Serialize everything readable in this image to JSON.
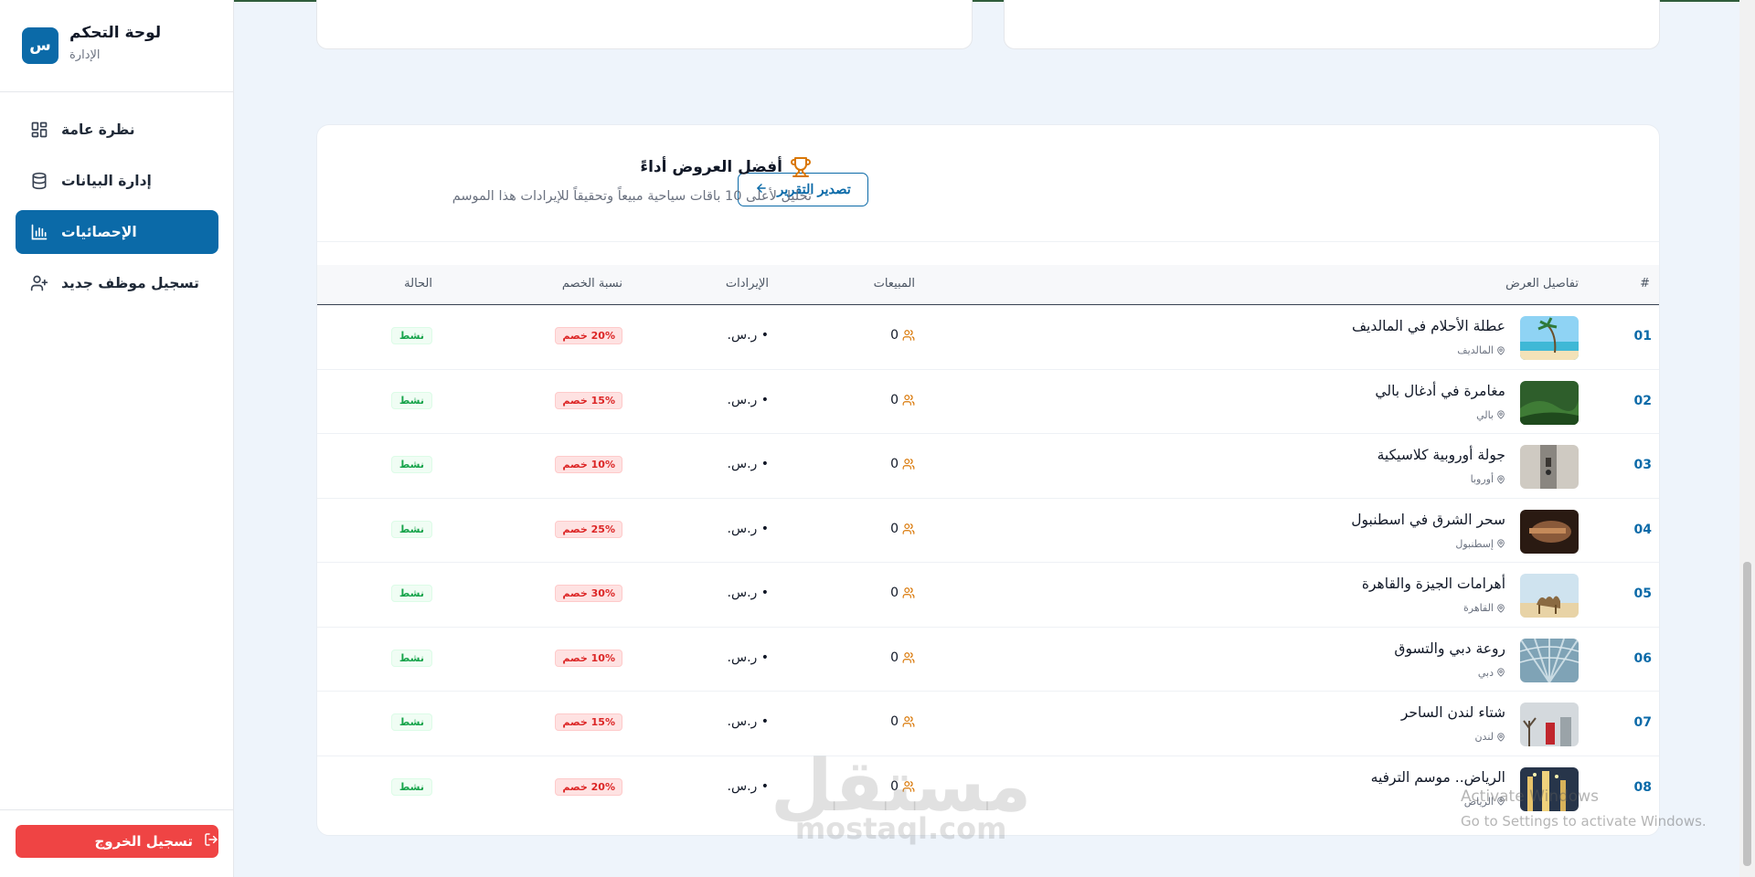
{
  "sidebar": {
    "brand_initial": "س",
    "brand_title": "لوحة التحكم",
    "brand_subtitle": "الإدارة",
    "items": [
      {
        "label": "نظرة عامة",
        "icon": "grid-icon",
        "active": false
      },
      {
        "label": "إدارة البيانات",
        "icon": "database-icon",
        "active": false
      },
      {
        "label": "الإحصائيات",
        "icon": "bar-chart-icon",
        "active": true
      },
      {
        "label": "تسجيل موظف جديد",
        "icon": "user-plus-icon",
        "active": false
      }
    ],
    "logout_label": "تسجيل الخروج"
  },
  "card": {
    "title": "أفضل العروض أداءً",
    "subtitle": "تحليل لأعلى 10 باقات سياحية مبيعاً وتحقيقاً للإيرادات هذا الموسم",
    "export_label": "تصدير التقرير"
  },
  "table": {
    "headers": {
      "num": "#",
      "details": "تفاصيل العرض",
      "sales": "المبيعات",
      "revenue": "الإيرادات",
      "discount": "نسبة الخصم",
      "status": "الحالة"
    },
    "rows": [
      {
        "num": "01",
        "title": "عطلة الأحلام في المالديف",
        "location": "المالديف",
        "sales": "0",
        "revenue": "• ر.س.",
        "discount": "20% خصم",
        "status": "نشط",
        "thumb": "beach"
      },
      {
        "num": "02",
        "title": "مغامرة في أدغال بالي",
        "location": "بالي",
        "sales": "0",
        "revenue": "• ر.س.",
        "discount": "15% خصم",
        "status": "نشط",
        "thumb": "jungle"
      },
      {
        "num": "03",
        "title": "جولة أوروبية كلاسيكية",
        "location": "أوروبا",
        "sales": "0",
        "revenue": "• ر.س.",
        "discount": "10% خصم",
        "status": "نشط",
        "thumb": "europe"
      },
      {
        "num": "04",
        "title": "سحر الشرق في اسطنبول",
        "location": "إسطنبول",
        "sales": "0",
        "revenue": "• ر.س.",
        "discount": "25% خصم",
        "status": "نشط",
        "thumb": "istanbul"
      },
      {
        "num": "05",
        "title": "أهرامات الجيزة والقاهرة",
        "location": "القاهرة",
        "sales": "0",
        "revenue": "• ر.س.",
        "discount": "30% خصم",
        "status": "نشط",
        "thumb": "camel"
      },
      {
        "num": "06",
        "title": "روعة دبي والتسوق",
        "location": "دبي",
        "sales": "0",
        "revenue": "• ر.س.",
        "discount": "10% خصم",
        "status": "نشط",
        "thumb": "dubai"
      },
      {
        "num": "07",
        "title": "شتاء لندن الساحر",
        "location": "لندن",
        "sales": "0",
        "revenue": "• ر.س.",
        "discount": "15% خصم",
        "status": "نشط",
        "thumb": "london"
      },
      {
        "num": "08",
        "title": "الرياض.. موسم الترفيه",
        "location": "الرياض",
        "sales": "0",
        "revenue": "• ر.س.",
        "discount": "20% خصم",
        "status": "نشط",
        "thumb": "riyadh"
      }
    ]
  },
  "overlay": {
    "watermark_ar": "مستقل",
    "watermark_en": "mostaql.com",
    "activate_title": "Activate Windows",
    "activate_sub": "Go to Settings to activate Windows."
  },
  "colors": {
    "primary": "#0b6aa8",
    "danger": "#ef4444",
    "success": "#16a34a",
    "accent": "#d97706"
  }
}
